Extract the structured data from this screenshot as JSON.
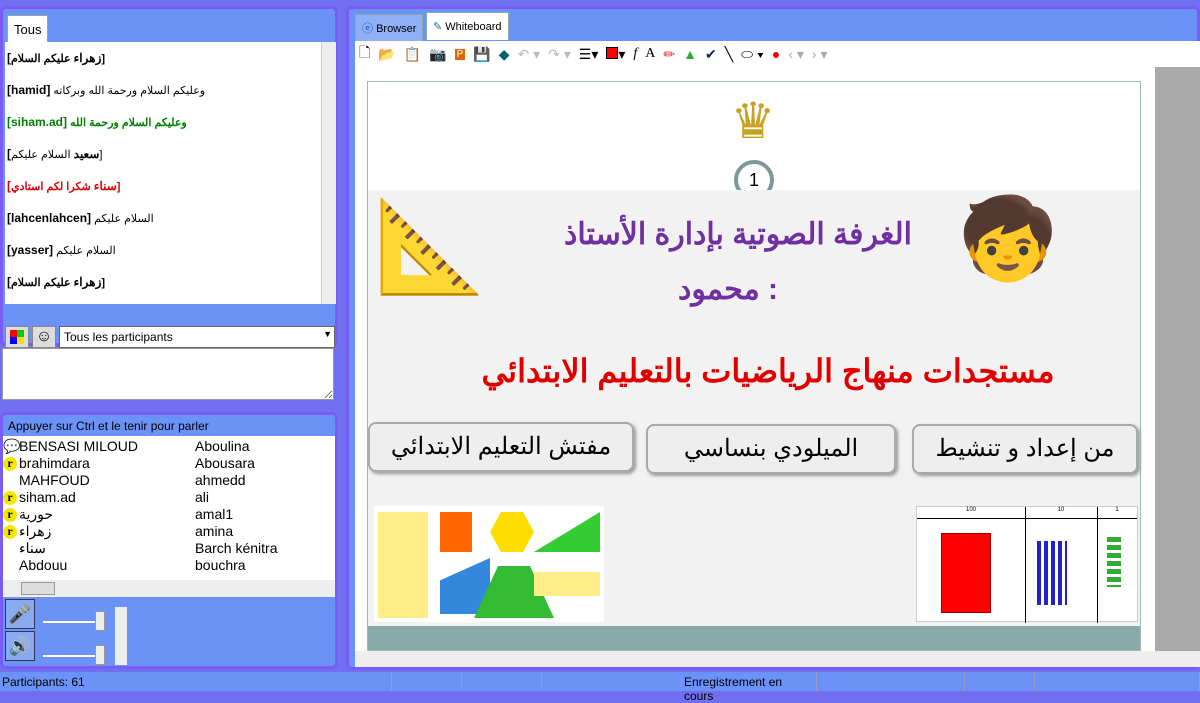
{
  "chat": {
    "tab": "Tous",
    "messages": [
      {
        "name": "[زهراء",
        "text": "عليكم السلام]",
        "color": "#000",
        "bold": true
      },
      {
        "name": "[hamid]",
        "text": "وعليكم السلام ورحمة الله وبركاته",
        "color": "#000",
        "bold": false
      },
      {
        "name": "[siham.ad]",
        "text": "وعليكم السلام ورحمة الله",
        "color": "#008000",
        "bold": true
      },
      {
        "name": "[سعيد",
        "text": "السلام عليكم]",
        "color": "#000",
        "bold": false
      },
      {
        "name": "[سناء",
        "text": "شكرا لكم استادي]",
        "color": "#e00000",
        "bold": true
      },
      {
        "name": "[lahcenlahcen]",
        "text": "السلام عليكم",
        "color": "#000",
        "bold": false
      },
      {
        "name": "[yasser]",
        "text": "السلام عليكم",
        "color": "#000",
        "bold": false
      },
      {
        "name": "[زهراء",
        "text": "عليكم السلام]",
        "color": "#000",
        "bold": true
      }
    ],
    "recipient": "Tous les participants"
  },
  "participants": {
    "hint": "Appuyer sur Ctrl et le tenir pour parler",
    "col1": [
      {
        "name": "BENSASI MILOUD",
        "icon": "speech"
      },
      {
        "name": "brahimdara",
        "icon": "r"
      },
      {
        "name": "MAHFOUD",
        "icon": ""
      },
      {
        "name": "siham.ad",
        "icon": "r"
      },
      {
        "name": "حورية",
        "icon": "r"
      },
      {
        "name": "زهراء",
        "icon": "r"
      },
      {
        "name": "سناء",
        "icon": ""
      },
      {
        "name": "Abdouu",
        "icon": ""
      }
    ],
    "col2": [
      "Aboulina",
      "Abousara",
      "ahmedd",
      "ali",
      "amal1",
      "amina",
      "Barch kénitra",
      "bouchra"
    ]
  },
  "whiteboard": {
    "tabs": [
      {
        "label": "Browser",
        "active": false
      },
      {
        "label": "Whiteboard",
        "active": true
      }
    ],
    "slide": {
      "page": "1",
      "title1": "الغرفة الصوتية بإدارة الأستاذ",
      "title2": "محمود :",
      "headline": "مستجدات منهاج الرياضيات بالتعليم الابتدائي",
      "box1": "مفتش التعليم الابتدائي",
      "box2": "الميلودي بنساسي",
      "box3": "من إعداد و تنشيط",
      "table_headers": [
        "100",
        "10",
        "1"
      ]
    }
  },
  "status": {
    "participants": "Participants: 61",
    "recording": "Enregistrement en cours"
  },
  "colors": {
    "accent": "#6b93f7",
    "border": "#7a5cf5",
    "title": "#7030a0",
    "headline": "#e00000"
  }
}
